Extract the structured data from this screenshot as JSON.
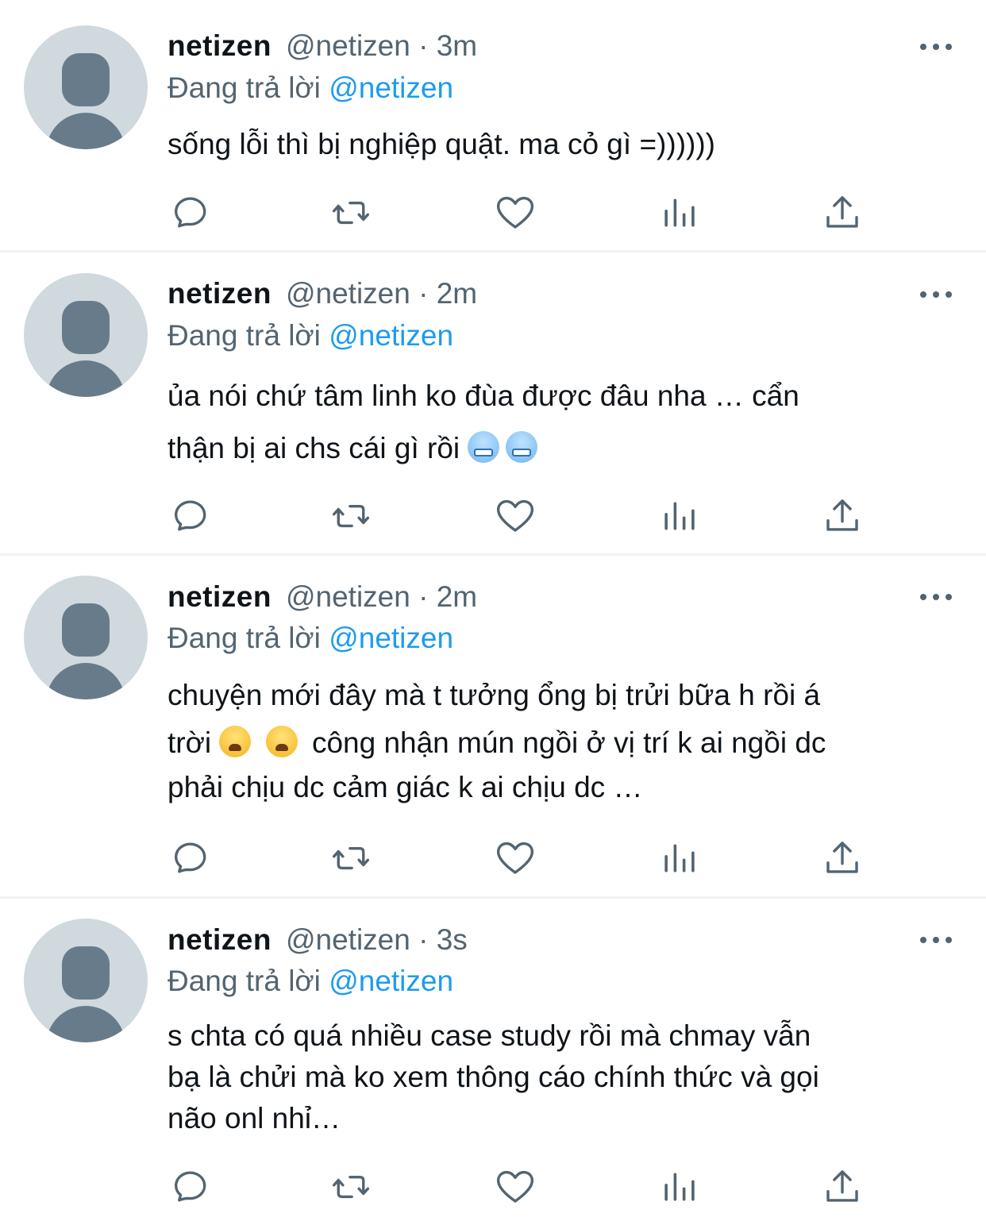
{
  "tweets": [
    {
      "name": "netizen",
      "handle": "@netizen",
      "dot": "·",
      "time": "3m",
      "reply_prefix": "Đang trả lời",
      "reply_to": "@netizen",
      "lines": [
        "sống lỗi thì bị nghiệp quật. ma cỏ gì =))))))"
      ]
    },
    {
      "name": "netizen",
      "handle": "@netizen",
      "dot": "·",
      "time": "2m",
      "reply_prefix": "Đang trả lời",
      "reply_to": "@netizen",
      "lines": [
        "ủa nói chứ tâm linh ko đùa được đâu nha … cẩn",
        "thận bị ai chs cái gì rồi"
      ]
    },
    {
      "name": "netizen",
      "handle": "@netizen",
      "dot": "·",
      "time": "2m",
      "reply_prefix": "Đang trả lời",
      "reply_to": "@netizen",
      "lines": [
        "chuyện mới đây mà t tưởng ổng bị trửi bữa h rồi á",
        "trời",
        "công nhận mún ngồi ở vị trí k ai ngồi dc",
        "phải chịu dc cảm giác k ai chịu dc …"
      ]
    },
    {
      "name": "netizen",
      "handle": "@netizen",
      "dot": "·",
      "time": "3s",
      "reply_prefix": "Đang trả lời",
      "reply_to": "@netizen",
      "lines": [
        "s chta có quá nhiều case study rồi mà chmay vẫn",
        "bạ là chửi mà ko xem thông cáo chính thức và gọi",
        "não onl nhỉ…"
      ]
    }
  ],
  "icons": {
    "reply": "reply-icon",
    "retweet": "retweet-icon",
    "like": "heart-icon",
    "views": "analytics-icon",
    "share": "share-icon",
    "more": "more-icon",
    "emoji_cold": "cold-face-emoji",
    "emoji_tired": "tired-face-emoji"
  },
  "colors": {
    "text": "#0f1419",
    "secondary": "#536471",
    "accent": "#1d9bf0",
    "avatar_bg": "#cfd9de",
    "avatar_fg": "#687b8a",
    "divider": "#eff3f4"
  }
}
